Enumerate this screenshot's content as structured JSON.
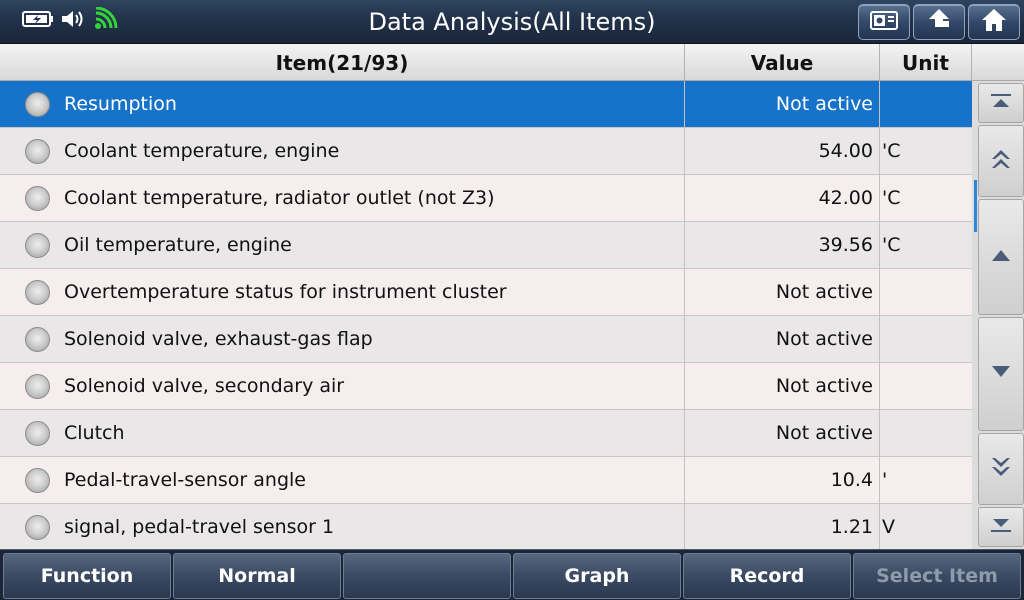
{
  "header": {
    "title": "Data Analysis(All Items)"
  },
  "status_icons": [
    "battery-charging-icon",
    "speaker-icon",
    "wifi-icon"
  ],
  "top_buttons": [
    "photo-icon",
    "back-icon",
    "home-icon"
  ],
  "table": {
    "columns": {
      "item": "Item(21/93)",
      "value": "Value",
      "unit": "Unit"
    },
    "rows": [
      {
        "name": "Resumption",
        "value": "Not active",
        "unit": "",
        "selected": true
      },
      {
        "name": "Coolant temperature, engine",
        "value": "54.00",
        "unit": "'C"
      },
      {
        "name": "Coolant temperature, radiator outlet (not Z3)",
        "value": "42.00",
        "unit": "'C"
      },
      {
        "name": "Oil temperature, engine",
        "value": "39.56",
        "unit": "'C"
      },
      {
        "name": "Overtemperature status for instrument cluster",
        "value": "Not active",
        "unit": ""
      },
      {
        "name": "Solenoid valve, exhaust-gas flap",
        "value": "Not active",
        "unit": ""
      },
      {
        "name": "Solenoid valve, secondary air",
        "value": "Not active",
        "unit": ""
      },
      {
        "name": "Clutch",
        "value": "Not active",
        "unit": ""
      },
      {
        "name": "Pedal-travel-sensor angle",
        "value": "10.4",
        "unit": "'"
      },
      {
        "name": "signal, pedal-travel sensor 1",
        "value": "1.21",
        "unit": "V"
      }
    ]
  },
  "bottom": {
    "function": "Function",
    "normal": "Normal",
    "blank": "",
    "graph": "Graph",
    "record": "Record",
    "select_item": "Select Item"
  },
  "colors": {
    "selected_row": "#1673c9",
    "wifi": "#35d33a"
  }
}
